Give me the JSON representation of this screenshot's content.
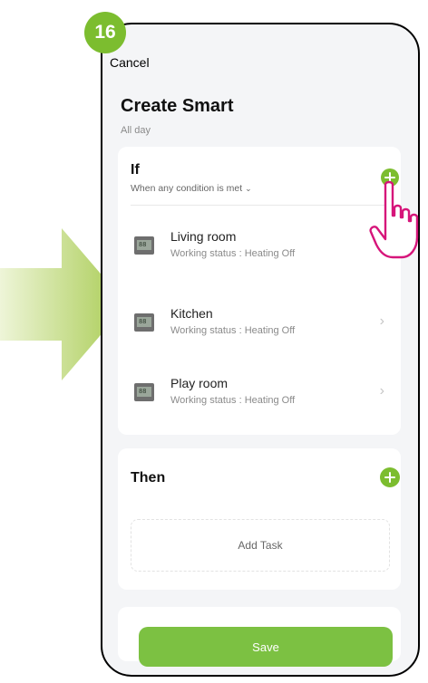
{
  "step_badge": "16",
  "header": {
    "cancel_label": "Cancel",
    "title": "Create Smart",
    "subtitle": "All day"
  },
  "if_section": {
    "label": "If",
    "condition": "When any condition is met",
    "add_icon": "plus-icon",
    "devices": [
      {
        "name": "Living room",
        "status": "Working status : Heating Off",
        "icon_text": "88"
      },
      {
        "name": "Kitchen",
        "status": "Working status : Heating Off",
        "icon_text": "88"
      },
      {
        "name": "Play room",
        "status": "Working status : Heating Off",
        "icon_text": "88"
      }
    ]
  },
  "then_section": {
    "label": "Then",
    "add_task_label": "Add Task",
    "add_icon": "plus-icon"
  },
  "save_label": "Save",
  "colors": {
    "accent_green": "#7cbd2f",
    "arrow_green": "#b7d46a",
    "hand_outline": "#d6157a"
  }
}
